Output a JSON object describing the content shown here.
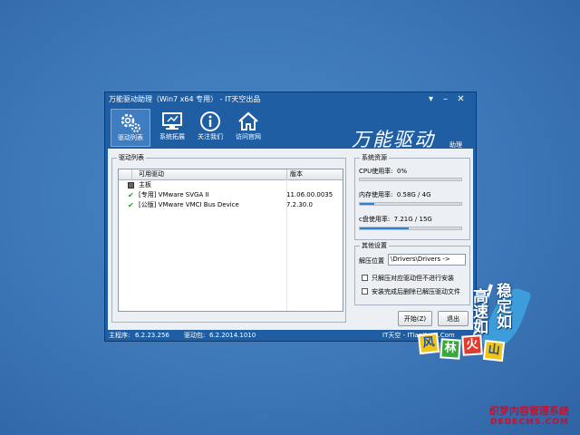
{
  "window": {
    "title": "万能驱动助理（Win7 x64 专用） - IT天空出品",
    "brand": "万能驱动",
    "brand_sub": "助理"
  },
  "toolbar": {
    "items": [
      {
        "label": "驱动列表",
        "icon": "gears-icon",
        "active": true
      },
      {
        "label": "系统拓展",
        "icon": "monitor-icon",
        "active": false
      },
      {
        "label": "关注我们",
        "icon": "info-icon",
        "active": false
      },
      {
        "label": "访问官网",
        "icon": "home-icon",
        "active": false
      }
    ]
  },
  "driver_list": {
    "title": "驱动列表",
    "columns": [
      "可用驱动",
      "版本"
    ],
    "group_label": "主板",
    "rows": [
      {
        "name": "[专用] VMware SVGA II",
        "version": "11.06.00.0035",
        "checked": true
      },
      {
        "name": "[公版] VMware VMCI Bus Device",
        "version": "7.2.30.0",
        "checked": true
      }
    ]
  },
  "resources": {
    "title": "系统资源",
    "cpu_label": "CPU使用率:",
    "cpu_value": "0%",
    "cpu_percent": 0,
    "mem_label": "内存使用率:",
    "mem_value": "0.58G / 4G",
    "mem_percent": 14.5,
    "disk_label": "c盘使用率:",
    "disk_value": "7.21G / 15G",
    "disk_percent": 48
  },
  "settings": {
    "title": "其他设置",
    "extract_label": "解压位置",
    "extract_value": "\\Drivers\\Drivers ->",
    "option1": "只解压对应驱动但不进行安装",
    "option2": "安装完成后删除已解压驱动文件"
  },
  "buttons": {
    "start": "开始(Z)",
    "exit": "退出"
  },
  "status": {
    "main_label": "主程序:",
    "main_version": "6.2.23.256",
    "pkg_label": "驱动包:",
    "pkg_version": "6.2.2014.1010",
    "site": "IT天空 - ITianKong.Com"
  },
  "logo": {
    "line1": "高速如",
    "line2": "稳定如",
    "tiles": [
      "风",
      "林",
      "火",
      "山"
    ]
  },
  "watermark": {
    "line1": "织梦内容管理系统",
    "line2": "DEDECMS.COM"
  }
}
